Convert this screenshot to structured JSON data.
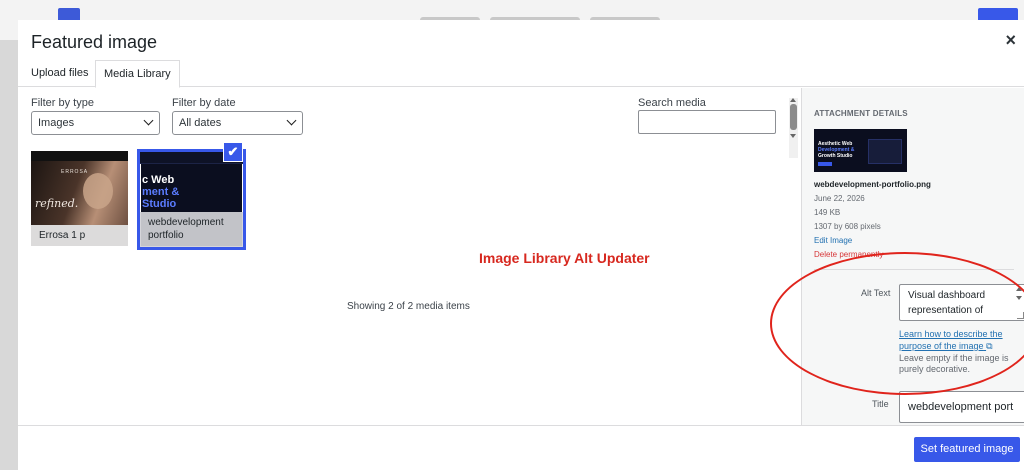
{
  "modal": {
    "title": "Featured image",
    "close_symbol": "×"
  },
  "tabs": [
    {
      "label": "Upload files",
      "active": false
    },
    {
      "label": "Media Library",
      "active": true
    }
  ],
  "filters": {
    "type_label": "Filter by type",
    "type_value": "Images",
    "date_label": "Filter by date",
    "date_value": "All dates",
    "search_label": "Search media",
    "search_value": ""
  },
  "media_items": [
    {
      "caption": "Errosa 1 p",
      "thumb_text": "refined.",
      "thumb_brand": "ERROSA",
      "selected": false
    },
    {
      "caption_line1": "webdevelopment",
      "caption_line2": "portfolio",
      "thumb_line1": "c Web",
      "thumb_line2": "ment &",
      "thumb_line3": "Studio",
      "selected": true,
      "check_symbol": "✔"
    }
  ],
  "overlay_title": "Image Library Alt Updater",
  "showing_text": "Showing 2 of 2 media items",
  "attachment": {
    "heading": "ATTACHMENT DETAILS",
    "thumb_line1": "Aesthetic Web",
    "thumb_line2": "Development &",
    "thumb_line3": "Growth Studio",
    "filename": "webdevelopment-portfolio.png",
    "date": "June 22, 2026",
    "size": "149 KB",
    "dimensions": "1307 by 608 pixels",
    "edit_link": "Edit Image",
    "delete_link": "Delete permanently",
    "alt_label": "Alt Text",
    "alt_value": "Visual dashboard representation of",
    "learn_link": "Learn how to describe the purpose of the image",
    "external_icon": "⧉",
    "hint": "Leave empty if the image is purely decorative.",
    "title_label": "Title",
    "title_value": "webdevelopment port"
  },
  "footer": {
    "set_button": "Set featured image"
  },
  "colors": {
    "accent": "#3858e9",
    "annotation_red": "#e0241c",
    "delete_red": "#d63638",
    "link_blue": "#2271b1"
  }
}
